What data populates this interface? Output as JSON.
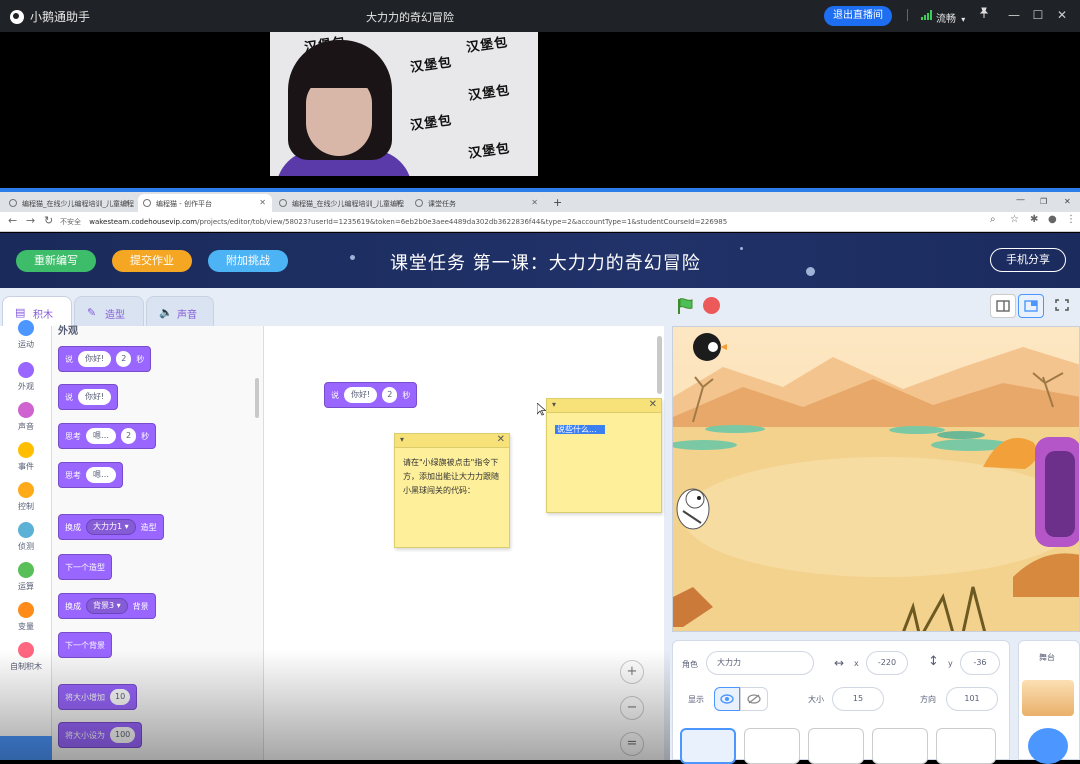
{
  "titlebar": {
    "app_name": "小鹅通助手",
    "window_title": "大力力的奇幻冒险",
    "exit_live_button": "退出直播间",
    "network_status": "流畅",
    "minimize": "—",
    "maximize": "☐",
    "close": "✕"
  },
  "video": {
    "watermark": "汉堡包"
  },
  "browser": {
    "tabs": [
      {
        "label": "编程猫_在线少儿编程培训_儿童编程"
      },
      {
        "label": "编程猫 - 创作平台"
      },
      {
        "label": "编程猫_在线少儿编程培训_儿童编程"
      },
      {
        "label": "课堂任务"
      }
    ],
    "new_tab": "+",
    "url_insecure": "不安全",
    "url_domain": "wakesteam.codehousevip.com",
    "url_path": "/projects/editor/tob/view/58023?userId=1235619&token=6eb2b0e3aee4489da302db3622836f44&type=2&accountType=1&studentCourseId=226985"
  },
  "app_header": {
    "btn_restart": "重新编写",
    "btn_submit": "提交作业",
    "btn_extra": "附加挑战",
    "title": "课堂任务 第一课：大力力的奇幻冒险",
    "btn_phone_share": "手机分享",
    "colors": {
      "restart": "#3dbd6a",
      "submit": "#f5a623",
      "extra": "#4cb3f5"
    }
  },
  "editor_tabs": {
    "code": "积木",
    "costumes": "造型",
    "sounds": "声音"
  },
  "categories": [
    {
      "label": "运动",
      "color": "#4c97ff"
    },
    {
      "label": "外观",
      "color": "#9966ff"
    },
    {
      "label": "声音",
      "color": "#cf63cf"
    },
    {
      "label": "事件",
      "color": "#ffbf00"
    },
    {
      "label": "控制",
      "color": "#ffab19"
    },
    {
      "label": "侦测",
      "color": "#5cb1d6"
    },
    {
      "label": "运算",
      "color": "#59c059"
    },
    {
      "label": "变量",
      "color": "#ff8c1a"
    },
    {
      "label": "自制积木",
      "color": "#ff6680"
    }
  ],
  "palette": {
    "section": "外观",
    "blocks": {
      "say_secs": {
        "a": "说",
        "text": "你好!",
        "num": "2",
        "b": "秒"
      },
      "say": {
        "a": "说",
        "text": "你好!"
      },
      "think_secs": {
        "a": "思考",
        "text": "嗯…",
        "num": "2",
        "b": "秒"
      },
      "think": {
        "a": "思考",
        "text": "嗯…"
      },
      "switch_costume": {
        "a": "换成",
        "dd": "大力力1",
        "b": "造型"
      },
      "next_costume": {
        "a": "下一个造型"
      },
      "switch_backdrop": {
        "a": "换成",
        "dd": "背景3",
        "b": "背景"
      },
      "next_backdrop": {
        "a": "下一个背景"
      },
      "change_size": {
        "a": "将大小增加",
        "num": "10"
      },
      "set_size": {
        "a": "将大小设为",
        "num": "100"
      }
    }
  },
  "workspace": {
    "block": {
      "a": "说",
      "text": "你好!",
      "num": "2",
      "b": "秒"
    },
    "note1": {
      "text": "请在\"小绿旗被点击\"指令下方，添加出能让大力力跟随小黑球闯关的代码："
    },
    "note2": {
      "text": "说些什么..."
    },
    "zoom_in": "+",
    "zoom_out": "−",
    "zoom_reset": "="
  },
  "sprite_info": {
    "sprite_label": "角色",
    "sprite_name": "大力力",
    "x_label": "x",
    "x_value": "-220",
    "y_label": "y",
    "y_value": "-36",
    "show_label": "显示",
    "size_label": "大小",
    "size_value": "15",
    "direction_label": "方向",
    "direction_value": "101"
  },
  "stage_panel": {
    "label": "舞台"
  }
}
